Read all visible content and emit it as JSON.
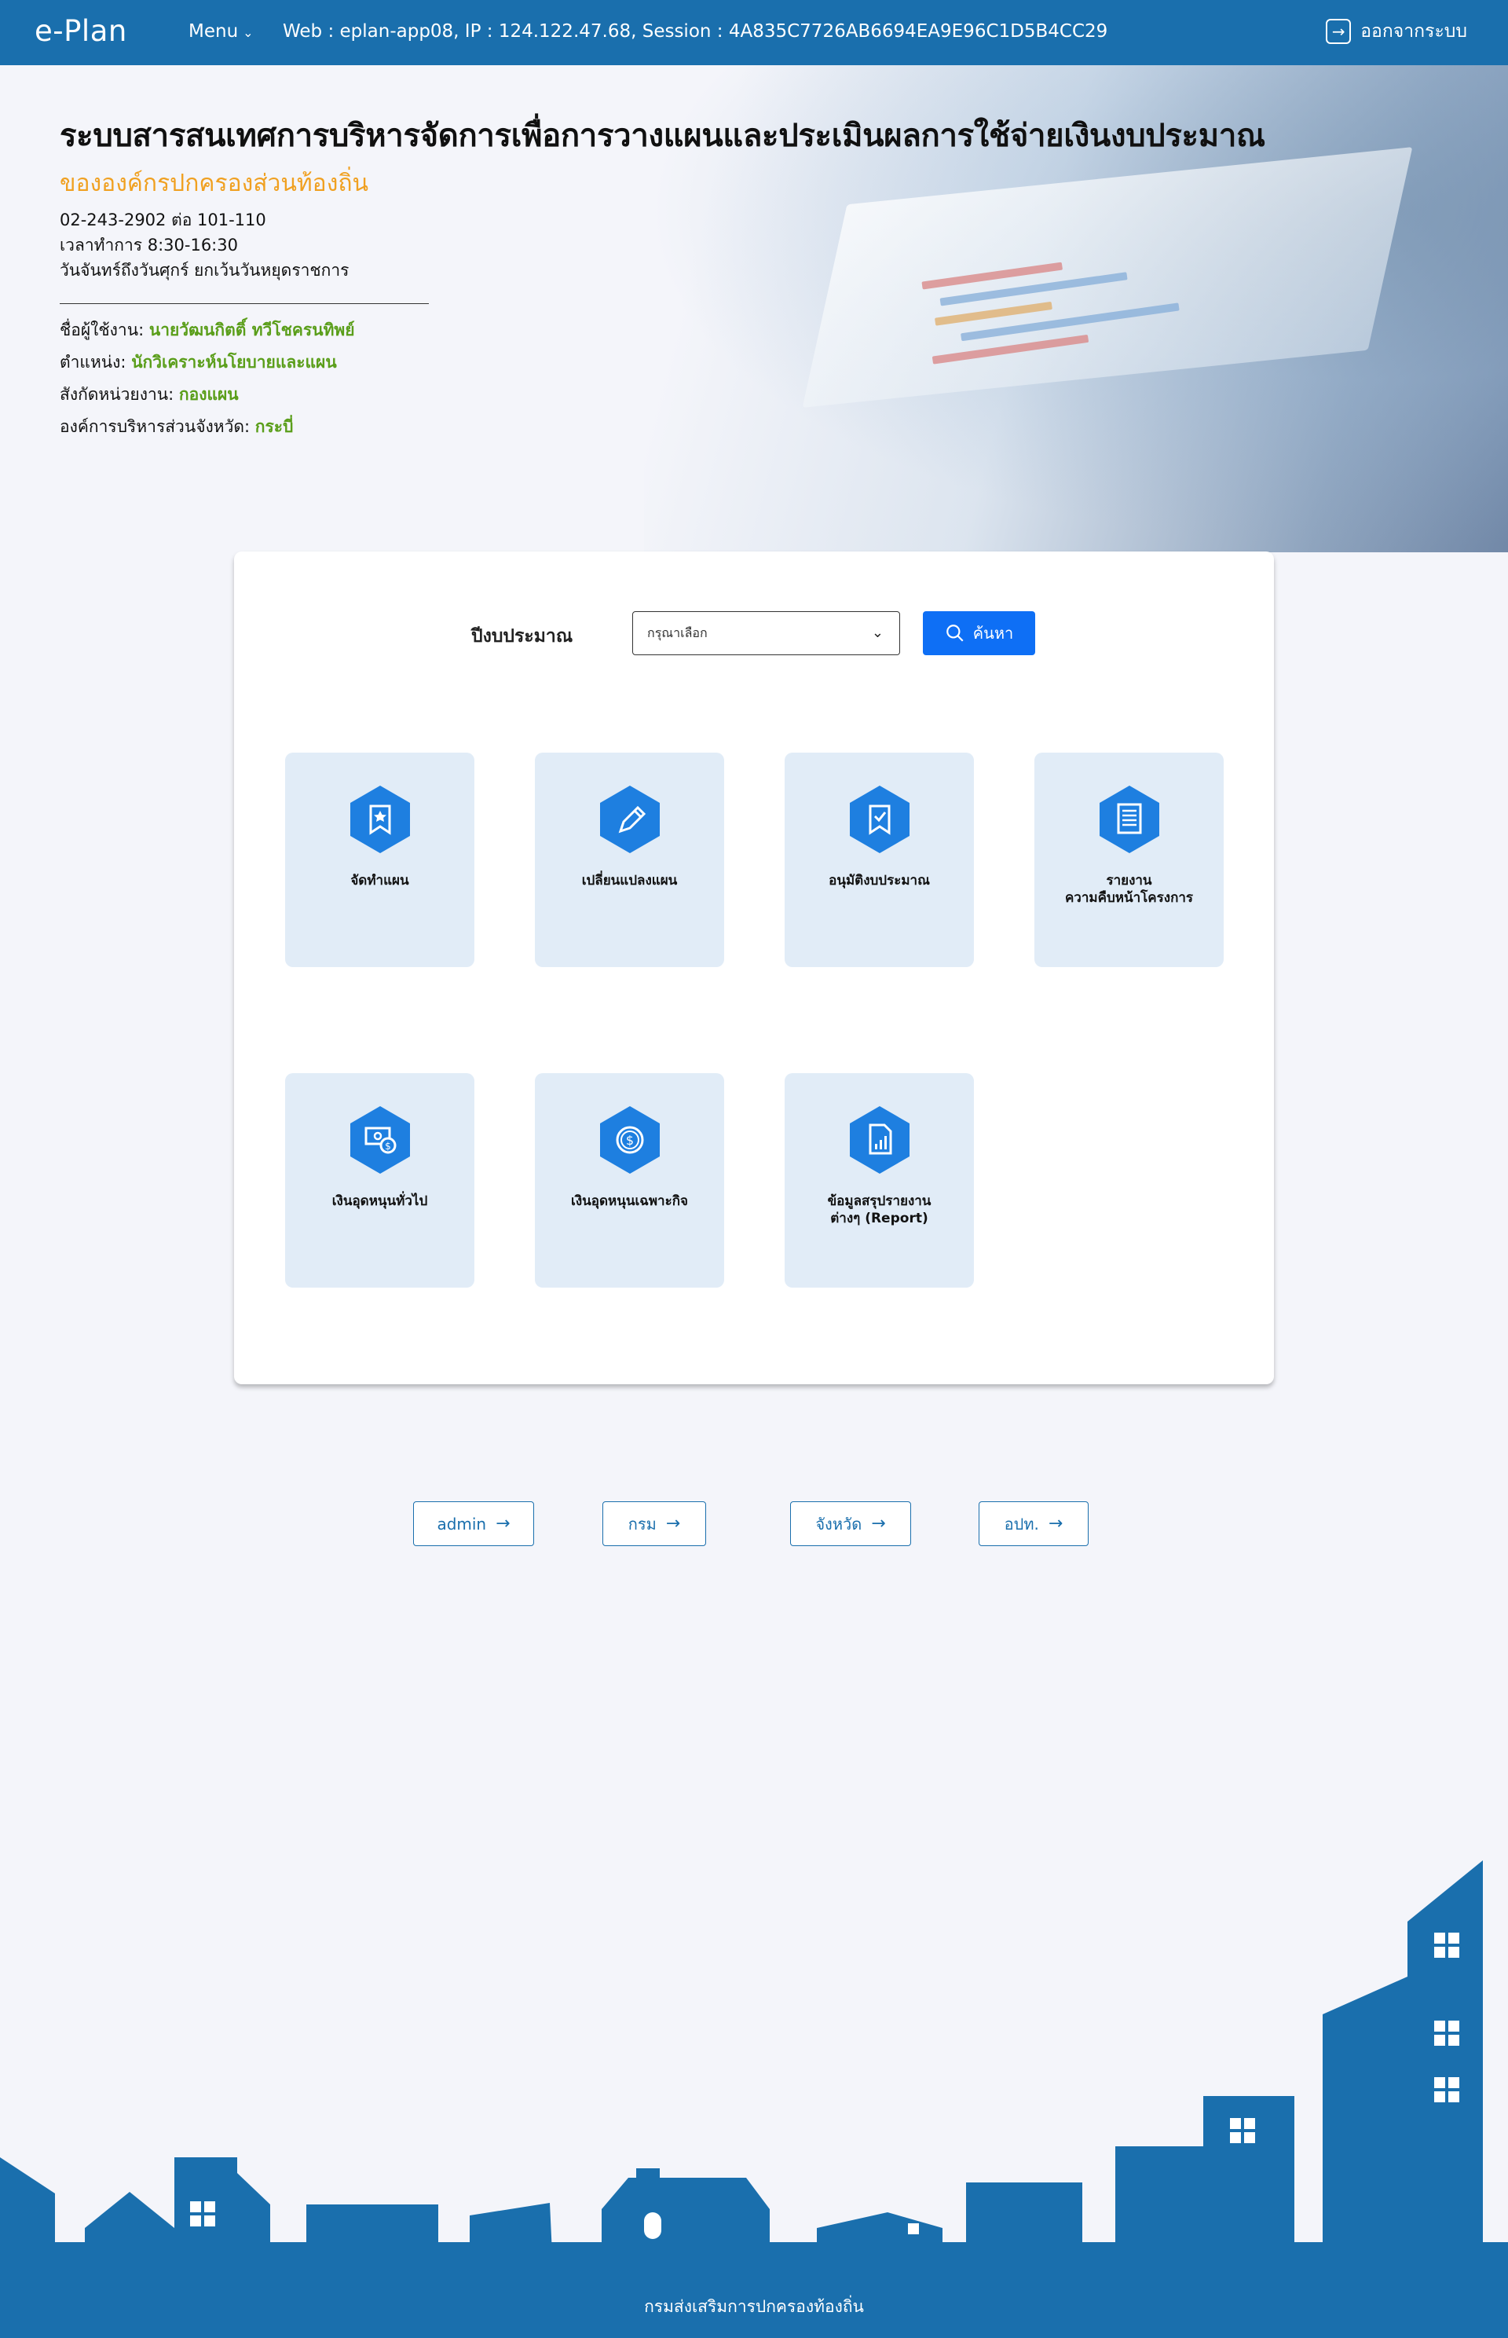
{
  "navbar": {
    "brand": "e-Plan",
    "menu_label": "Menu",
    "session_info": "Web : eplan-app08, IP : 124.122.47.68, Session : 4A835C7726AB6694EA9E96C1D5B4CC29",
    "logout_label": "ออกจากระบบ"
  },
  "hero": {
    "title": "ระบบสารสนเทศการบริหารจัดการเพื่อการวางแผนและประเมินผลการใช้จ่ายเงินงบประมาณ",
    "subtitle": "ขององค์กรปกครองส่วนท้องถิ่น",
    "contact": {
      "phone": "02-243-2902 ต่อ 101-110",
      "hours": "เวลาทำการ 8:30-16:30",
      "days": "วันจันทร์ถึงวันศุกร์ ยกเว้นวันหยุดราชการ"
    },
    "user": {
      "name_label": "ชื่อผู้ใช้งาน:",
      "name_value": "นายวัฒนกิตติ์ ทวีโชครนทิพย์",
      "position_label": "ตำแหน่ง:",
      "position_value": "นักวิเคราะห์นโยบายและแผน",
      "unit_label": "สังกัดหน่วยงาน:",
      "unit_value": "กองแผน",
      "org_label": "องค์การบริหารส่วนจังหวัด:",
      "org_value": "กระบี่"
    }
  },
  "search": {
    "label": "ปีงบประมาณ",
    "select_value": "กรุณาเลือก",
    "button_label": "ค้นหา"
  },
  "tiles": [
    {
      "label": "จัดทำแผน",
      "icon": "bookmark-star-icon"
    },
    {
      "label": "เปลี่ยนแปลงแผน",
      "icon": "pencil-icon"
    },
    {
      "label": "อนุมัติงบประมาณ",
      "icon": "bookmark-check-icon"
    },
    {
      "label": "รายงาน\nความคืบหน้าโครงการ",
      "icon": "document-list-icon"
    },
    {
      "label": "เงินอุดหนุนทั่วไป",
      "icon": "money-cash-icon"
    },
    {
      "label": "เงินอุดหนุนเฉพาะกิจ",
      "icon": "dollar-coin-icon"
    },
    {
      "label": "ข้อมูลสรุปรายงาน\nต่างๆ (Report)",
      "icon": "report-chart-icon"
    }
  ],
  "roles": [
    {
      "label": "admin"
    },
    {
      "label": "กรม"
    },
    {
      "label": "จังหวัด"
    },
    {
      "label": "อปท."
    }
  ],
  "footer": {
    "text": "กรมส่งเสริมการปกครองท้องถิ่น"
  },
  "colors": {
    "primary": "#1a6fad",
    "accent_blue": "#0e6ff5",
    "hex_icon": "#1e7fe0",
    "tile_bg": "#e1ecf7",
    "subtitle": "#f0a020",
    "user_value": "#5a9e1a"
  }
}
